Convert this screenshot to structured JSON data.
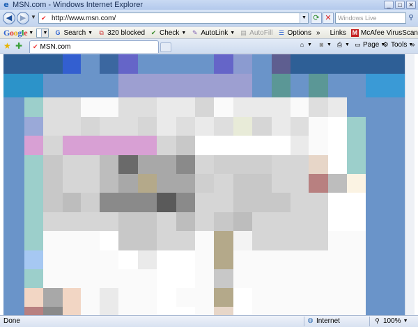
{
  "window": {
    "title": "MSN.com - Windows Internet Explorer",
    "minimize": "_",
    "maximize": "□",
    "close": "✕"
  },
  "address_bar": {
    "url": "http://www.msn.com/",
    "search_placeholder": "Windows Live"
  },
  "google_toolbar": {
    "logo": [
      "G",
      "o",
      "o",
      "g",
      "l",
      "e"
    ],
    "search_label": "Search",
    "blocked_label": "320 blocked",
    "check_label": "Check",
    "autolink_label": "AutoLink",
    "autofill_label": "AutoFill",
    "options_label": "Options",
    "more_label": "»",
    "links_label": "Links",
    "mcafee_label": "McAfee VirusScan"
  },
  "tabs": [
    {
      "label": "MSN.com"
    }
  ],
  "command_bar": {
    "page_label": "Page",
    "tools_label": "Tools",
    "more_label": "»"
  },
  "status_bar": {
    "left": "Done",
    "zone": "Internet",
    "zoom": "100%"
  },
  "icons": {
    "back": "back-arrow-icon",
    "forward": "forward-arrow-icon",
    "refresh": "refresh-icon",
    "stop": "stop-icon",
    "search": "magnifier-icon",
    "favorites": "star-icon",
    "add_favorites": "add-favorites-icon",
    "home": "home-icon",
    "feeds": "feeds-icon",
    "print": "printer-icon",
    "internet_zone": "globe-icon"
  }
}
